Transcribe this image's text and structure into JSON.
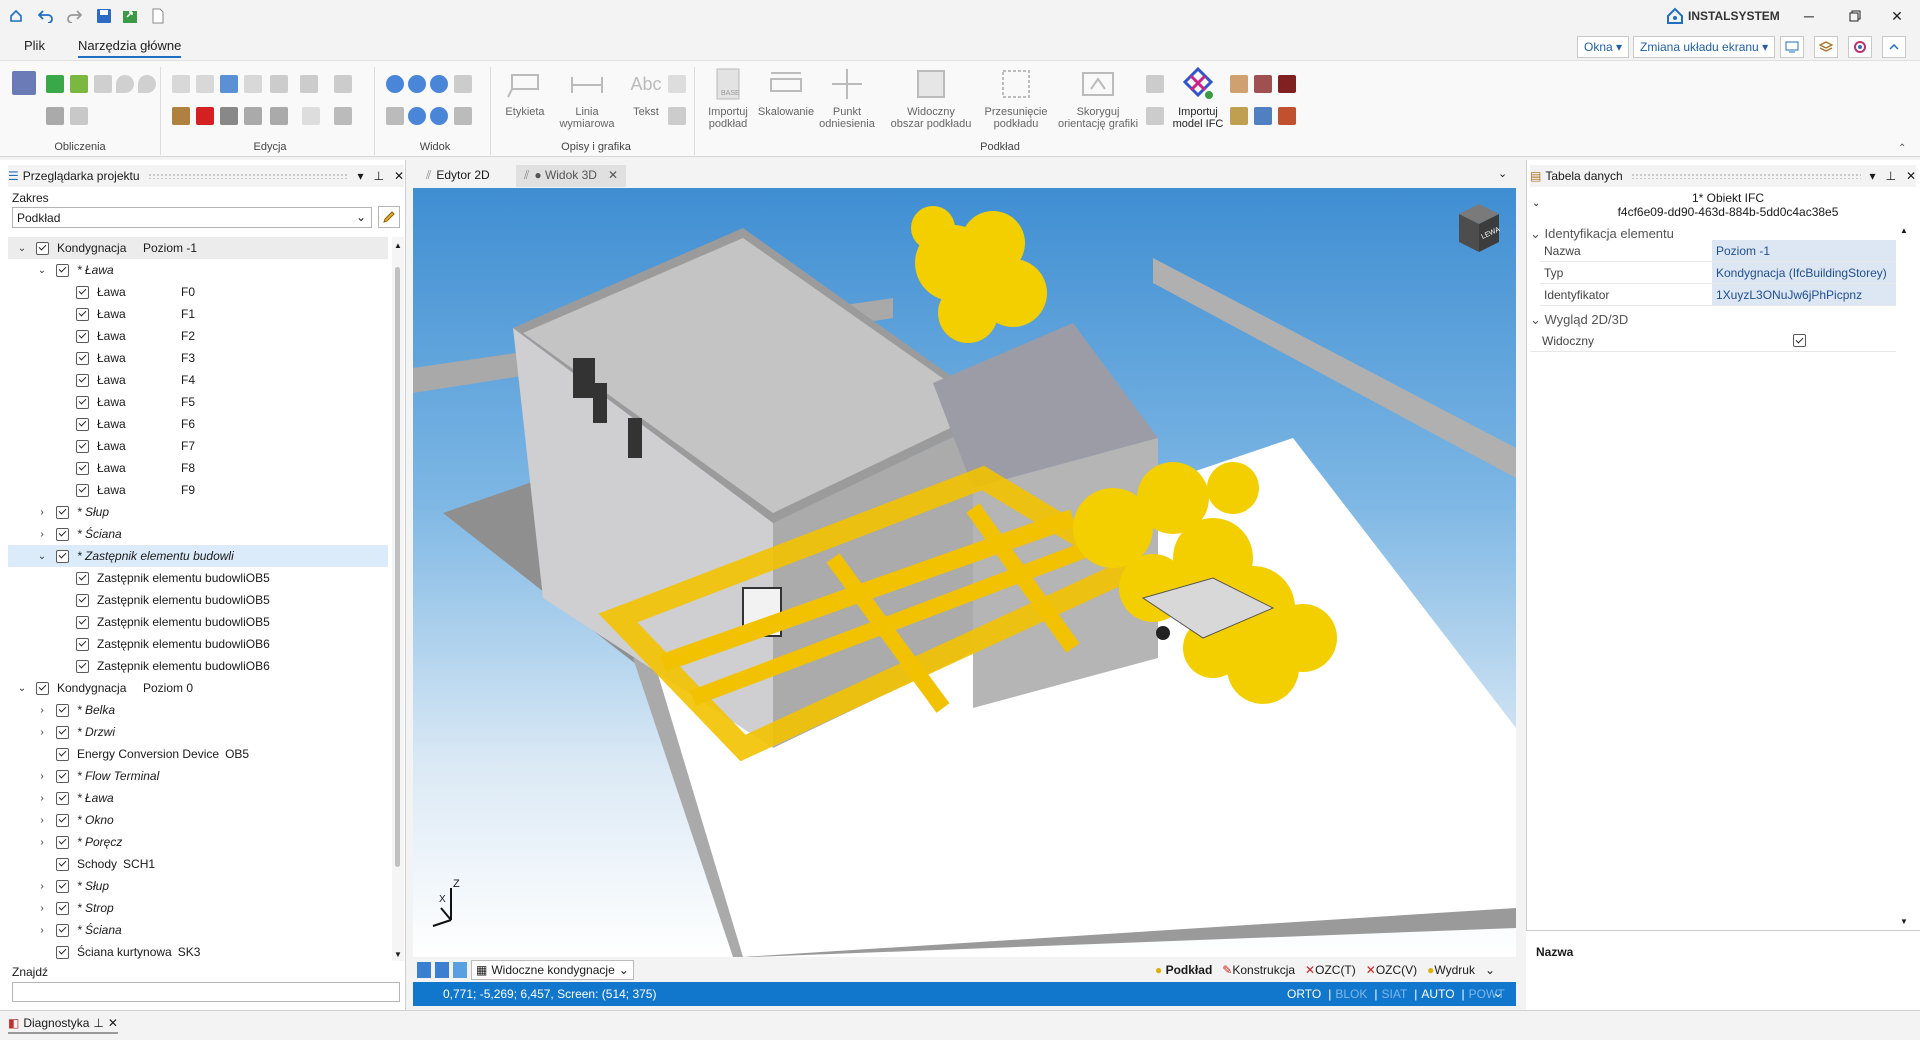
{
  "app": {
    "brand": "INSTALSYSTEM"
  },
  "menu": {
    "tabs": [
      "Plik",
      "Narzędzia główne"
    ],
    "right": {
      "windows": "Okna",
      "layout": "Zmiana układu ekranu"
    }
  },
  "ribbon": {
    "groups": [
      "Obliczenia",
      "Edycja",
      "Widok",
      "Opisy i grafika",
      "Podkład"
    ],
    "buttons": {
      "labels": "Etykieta",
      "dim_line": "Linia\nwymiarowa",
      "text": "Tekst",
      "import_bg": "Importuj\npodkład",
      "scale": "Skalowanie",
      "ref_point": "Punkt\nodniesienia",
      "visible_area": "Widoczny\nobszar podkładu",
      "move_bg": "Przesunięcie\npodkładu",
      "fix_orient": "Skoryguj\norientację grafiki",
      "import_ifc": "Importuj\nmodel IFC"
    }
  },
  "browser": {
    "title": "Przeglądarka projektu",
    "scope_label": "Zakres",
    "scope_value": "Podkład",
    "find_label": "Znajdź",
    "find_value": ""
  },
  "tree": [
    {
      "d": 0,
      "exp": "v",
      "name": "Kondygnacja",
      "code": "Poziom -1",
      "it": false,
      "sel": false
    },
    {
      "d": 1,
      "exp": "v",
      "name": "* Ława",
      "code": "",
      "it": true
    },
    {
      "d": 2,
      "name": "Ława",
      "code": "F0"
    },
    {
      "d": 2,
      "name": "Ława",
      "code": "F1"
    },
    {
      "d": 2,
      "name": "Ława",
      "code": "F2"
    },
    {
      "d": 2,
      "name": "Ława",
      "code": "F3"
    },
    {
      "d": 2,
      "name": "Ława",
      "code": "F4"
    },
    {
      "d": 2,
      "name": "Ława",
      "code": "F5"
    },
    {
      "d": 2,
      "name": "Ława",
      "code": "F6"
    },
    {
      "d": 2,
      "name": "Ława",
      "code": "F7"
    },
    {
      "d": 2,
      "name": "Ława",
      "code": "F8"
    },
    {
      "d": 2,
      "name": "Ława",
      "code": "F9"
    },
    {
      "d": 1,
      "exp": ">",
      "name": "* Słup",
      "code": "",
      "it": true
    },
    {
      "d": 1,
      "exp": ">",
      "name": "* Ściana",
      "code": "",
      "it": true
    },
    {
      "d": 1,
      "exp": "v",
      "name": "* Zastępnik elementu budowli",
      "code": "",
      "it": true,
      "sel": true
    },
    {
      "d": 2,
      "name": "Zastępnik elementu budowli",
      "code": "OB5"
    },
    {
      "d": 2,
      "name": "Zastępnik elementu budowli",
      "code": "OB5"
    },
    {
      "d": 2,
      "name": "Zastępnik elementu budowli",
      "code": "OB5"
    },
    {
      "d": 2,
      "name": "Zastępnik elementu budowli",
      "code": "OB6"
    },
    {
      "d": 2,
      "name": "Zastępnik elementu budowli",
      "code": "OB6"
    },
    {
      "d": 0,
      "exp": "v",
      "name": "Kondygnacja",
      "code": "Poziom 0"
    },
    {
      "d": 1,
      "exp": ">",
      "name": "* Belka",
      "code": "",
      "it": true
    },
    {
      "d": 1,
      "exp": ">",
      "name": "* Drzwi",
      "code": "",
      "it": true
    },
    {
      "d": 1,
      "name": "Energy Conversion Device",
      "code": "OB5"
    },
    {
      "d": 1,
      "exp": ">",
      "name": "* Flow Terminal",
      "code": "",
      "it": true
    },
    {
      "d": 1,
      "exp": ">",
      "name": "* Ława",
      "code": "",
      "it": true
    },
    {
      "d": 1,
      "exp": ">",
      "name": "* Okno",
      "code": "",
      "it": true
    },
    {
      "d": 1,
      "exp": ">",
      "name": "* Poręcz",
      "code": "",
      "it": true
    },
    {
      "d": 1,
      "name": "Schody",
      "code": "SCH1"
    },
    {
      "d": 1,
      "exp": ">",
      "name": "* Słup",
      "code": "",
      "it": true
    },
    {
      "d": 1,
      "exp": ">",
      "name": "* Strop",
      "code": "",
      "it": true
    },
    {
      "d": 1,
      "exp": ">",
      "name": "* Ściana",
      "code": "",
      "it": true
    },
    {
      "d": 1,
      "name": "Ściana kurtynowa",
      "code": "SK3"
    }
  ],
  "doc_tabs": [
    {
      "label": "Edytor 2D"
    },
    {
      "label": "● Widok 3D"
    }
  ],
  "viewport": {
    "cube_label": "LEWA",
    "axis_z": "Z",
    "axis_x": "X"
  },
  "viewbar": {
    "visible_storeys": "Widoczne kondygnacje",
    "layers": [
      "Podkład",
      "Konstrukcja",
      "OZC(T)",
      "OZC(V)",
      "Wydruk"
    ]
  },
  "status": {
    "coords": "0,771; -5,269; 6,457, Screen: (514; 375)",
    "modes": [
      {
        "t": "ORTO",
        "on": true
      },
      {
        "t": "BLOK",
        "on": false
      },
      {
        "t": "SIAT",
        "on": false
      },
      {
        "t": "AUTO",
        "on": true
      },
      {
        "t": "POWT",
        "on": false
      }
    ]
  },
  "datatable": {
    "title": "Tabela danych",
    "header1": "1* Obiekt IFC",
    "header2": "f4cf6e09-dd90-463d-884b-5dd0c4ac38e5",
    "section1": "Identyfikacja elementu",
    "rows": [
      {
        "k": "Nazwa",
        "v": "Poziom -1"
      },
      {
        "k": "Typ",
        "v": "Kondygnacja (IfcBuildingStorey)"
      },
      {
        "k": "Identyfikator",
        "v": "1XuyzL3ONuJw6jPhPicpnz"
      }
    ],
    "section2": "Wygląd 2D/3D",
    "visible_label": "Widoczny",
    "footer_label": "Nazwa"
  },
  "bottom": {
    "diag": "Diagnostyka"
  }
}
